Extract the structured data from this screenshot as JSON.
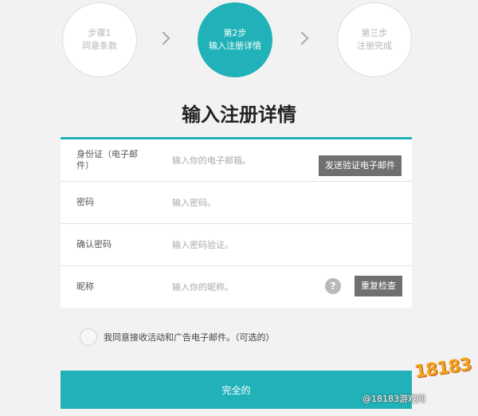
{
  "steps": [
    {
      "line1": "步骤1",
      "line2": "同意条款",
      "active": false
    },
    {
      "line1": "第2步",
      "line2": "输入注册详情",
      "active": true
    },
    {
      "line1": "第三步",
      "line2": "注册完成",
      "active": false
    }
  ],
  "title": "输入注册详情",
  "form": {
    "email": {
      "label": "身份证（电子邮件）",
      "placeholder": "输入你的电子邮箱。",
      "button": "发送验证电子邮件"
    },
    "password": {
      "label": "密码",
      "placeholder": "输入密码。"
    },
    "confirm": {
      "label": "确认密码",
      "placeholder": "输入密码验证。"
    },
    "nickname": {
      "label": "昵称",
      "placeholder": "输入你的昵称。",
      "help": "?",
      "button": "重复检查"
    }
  },
  "agree_text": "我同意接收活动和广告电子邮件。（可选的）",
  "submit_label": "完全的",
  "watermark": {
    "logo": "18183",
    "text": "@18183游戏网"
  },
  "colors": {
    "accent": "#20b2b8",
    "button": "#707070",
    "background": "#f2f2f2"
  }
}
